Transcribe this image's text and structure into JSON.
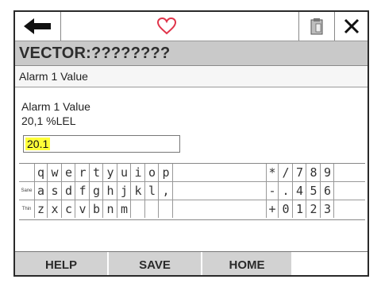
{
  "header": {
    "back_icon": "arrow-left-icon",
    "favorite_icon": "heart-outline-icon",
    "clipboard_icon": "clipboard-icon",
    "close_icon": "close-icon"
  },
  "title": "VECTOR:????????",
  "subtitle": "Alarm 1 Value",
  "field": {
    "label": "Alarm 1 Value",
    "current": "20,1 %LEL",
    "value": "20.1"
  },
  "keyboard": {
    "row_labels": [
      "",
      "Sane",
      "Thin"
    ],
    "rows": [
      [
        "q",
        "w",
        "e",
        "r",
        "t",
        "y",
        "u",
        "i",
        "o",
        "p"
      ],
      [
        "a",
        "s",
        "d",
        "f",
        "g",
        "h",
        "j",
        "k",
        "l",
        ","
      ],
      [
        "z",
        "x",
        "c",
        "v",
        "b",
        "n",
        "m",
        "",
        "",
        ""
      ]
    ],
    "num_rows": [
      [
        "*",
        "/",
        "7",
        "8",
        "9"
      ],
      [
        "-",
        ".",
        "4",
        "5",
        "6"
      ],
      [
        "+",
        "0",
        "1",
        "2",
        "3"
      ]
    ]
  },
  "buttons": {
    "help": "HELP",
    "save": "SAVE",
    "home": "HOME"
  },
  "colors": {
    "title_bar": "#c9c9c9",
    "highlight": "#ffff38",
    "button": "#d2d2d2",
    "heart": "#e0344a"
  }
}
